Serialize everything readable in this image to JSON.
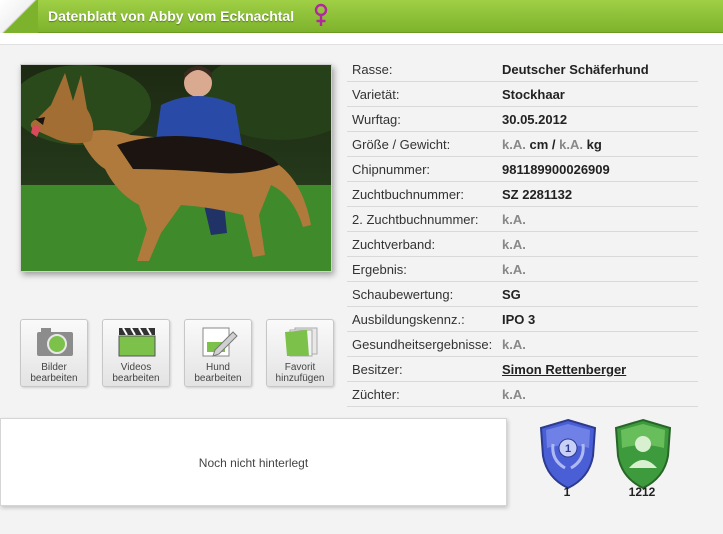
{
  "header": {
    "title": "Datenblatt von Abby vom Ecknachtal",
    "gender_icon": "female-symbol-icon",
    "accent": "#8cc13c"
  },
  "photo": {
    "alt": "german-shepherd-photo"
  },
  "actions": [
    {
      "id": "edit-images",
      "icon": "camera-icon",
      "line1": "Bilder",
      "line2": "bearbeiten"
    },
    {
      "id": "edit-videos",
      "icon": "clapperboard-icon",
      "line1": "Videos",
      "line2": "bearbeiten"
    },
    {
      "id": "edit-dog",
      "icon": "pencil-icon",
      "line1": "Hund",
      "line2": "bearbeiten"
    },
    {
      "id": "add-favorite",
      "icon": "favorites-icon",
      "line1": "Favorit",
      "line2": "hinzufügen"
    }
  ],
  "details": {
    "rasse": {
      "label": "Rasse:",
      "value": "Deutscher Schäferhund"
    },
    "varietaet": {
      "label": "Varietät:",
      "value": "Stockhaar"
    },
    "wurftag": {
      "label": "Wurftag:",
      "value": "30.05.2012"
    },
    "groesse": {
      "label": "Größe / Gewicht:",
      "height": "k.A.",
      "height_unit": "cm",
      "sep": "/",
      "weight": "k.A.",
      "weight_unit": "kg"
    },
    "chip": {
      "label": "Chipnummer:",
      "value": "981189900026909"
    },
    "zuchtbuch": {
      "label": "Zuchtbuchnummer:",
      "value": "SZ 2281132"
    },
    "zuchtbuch2": {
      "label": "2. Zuchtbuchnummer:",
      "value": "k.A."
    },
    "verband": {
      "label": "Zuchtverband:",
      "value": "k.A."
    },
    "ergebnis": {
      "label": "Ergebnis:",
      "value": "k.A."
    },
    "schau": {
      "label": "Schaubewertung:",
      "value": "SG"
    },
    "ausbildung": {
      "label": "Ausbildungskennz.:",
      "value": "IPO 3"
    },
    "gesundheit": {
      "label": "Gesundheitsergebnisse:",
      "value": "k.A."
    },
    "besitzer": {
      "label": "Besitzer:",
      "value": "Simon Rettenberger"
    },
    "zuechter": {
      "label": "Züchter:",
      "value": "k.A."
    }
  },
  "notes": {
    "text": "Noch nicht hinterlegt"
  },
  "badges": [
    {
      "icon": "laurel-shield-icon",
      "number": "1",
      "value": "1",
      "color": "#4a5fd6"
    },
    {
      "icon": "user-shield-icon",
      "value": "1212",
      "color": "#3d9a3d"
    }
  ]
}
